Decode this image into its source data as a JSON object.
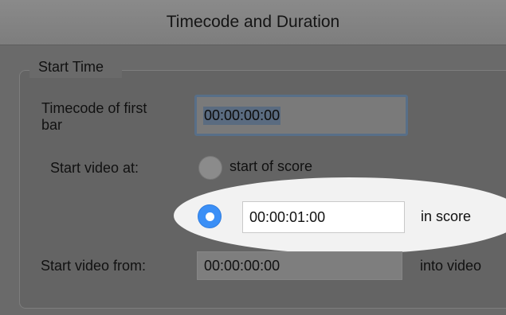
{
  "dialog": {
    "title": "Timecode and Duration"
  },
  "start_time": {
    "group_label": "Start Time",
    "timecode_label_line1": "Timecode of first",
    "timecode_label_line2": "bar",
    "timecode_value": "00:00:00:00",
    "start_video_at_label": "Start video at:",
    "option_start_of_score": "start of score",
    "option_custom_value": "00:00:01:00",
    "option_custom_suffix": "in score",
    "selected_option": "custom",
    "start_video_from_label": "Start video from:",
    "start_video_from_value": "00:00:00:00",
    "start_video_from_suffix": "into video"
  },
  "colors": {
    "accent": "#3b8ff6",
    "focus_ring": "#586f88",
    "highlight": "#f2f2f2"
  }
}
